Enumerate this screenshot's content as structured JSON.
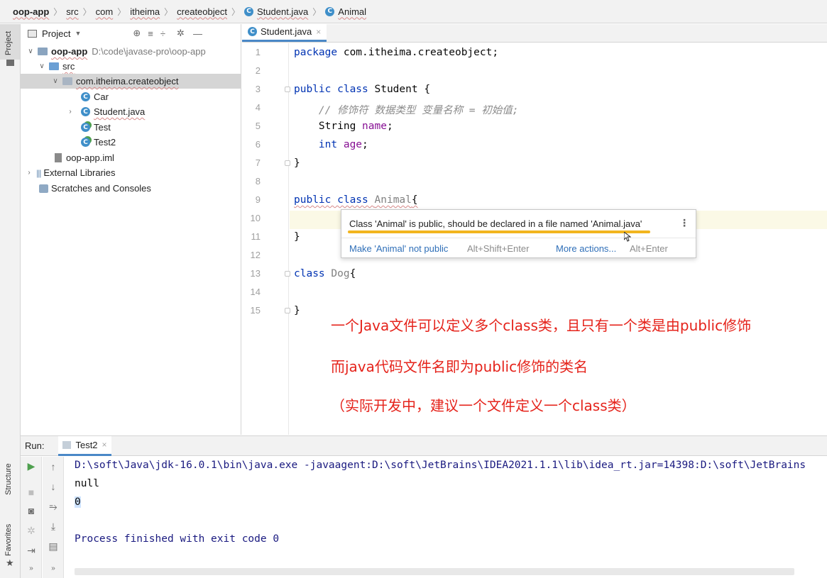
{
  "breadcrumbs": [
    "oop-app",
    "src",
    "com",
    "itheima",
    "createobject",
    "Student.java",
    "Animal"
  ],
  "left_strip": {
    "project_tab": "Project",
    "structure_tab": "Structure",
    "favorites_tab": "Favorites"
  },
  "project_panel": {
    "title": "Project",
    "tree": [
      {
        "label": "oop-app",
        "path": "D:\\code\\javase-pro\\oop-app"
      },
      {
        "label": "src"
      },
      {
        "label": "com.itheima.createobject"
      },
      {
        "label": "Car"
      },
      {
        "label": "Student.java"
      },
      {
        "label": "Test"
      },
      {
        "label": "Test2"
      },
      {
        "label": "oop-app.iml"
      },
      {
        "label": "External Libraries"
      },
      {
        "label": "Scratches and Consoles"
      }
    ]
  },
  "editor": {
    "tab": "Student.java",
    "line_numbers": [
      "1",
      "2",
      "3",
      "4",
      "5",
      "6",
      "7",
      "8",
      "9",
      "10",
      "11",
      "12",
      "13",
      "14",
      "15"
    ],
    "lines": {
      "l1_kw": "package",
      "l1_rest": " com.itheima.createobject;",
      "l3_kw": "public class",
      "l3_rest": " Student {",
      "l4": "    // 修饰符 数据类型 变量名称 = 初始值;",
      "l5_type": "    String ",
      "l5_field": "name",
      "l5_end": ";",
      "l6_type": "    int",
      "l6_sp": " ",
      "l6_field": "age",
      "l6_end": ";",
      "l7": "}",
      "l9_kw": "public class",
      "l9_sp": " ",
      "l9_name": "Animal",
      "l9_end": "{",
      "l11": "}",
      "l13_kw": "class",
      "l13_sp": " ",
      "l13_name": "Dog",
      "l13_end": "{",
      "l15": "}"
    }
  },
  "popup": {
    "message": "Class 'Animal' is public, should be declared in a file named 'Animal.java'",
    "fix_label": "Make 'Animal' not public",
    "fix_shortcut": "Alt+Shift+Enter",
    "more_label": "More actions...",
    "more_shortcut": "Alt+Enter"
  },
  "annotations": [
    "一个Java文件可以定义多个class类，且只有一个类是由public修饰",
    "而java代码文件名即为public修饰的类名",
    "（实际开发中，建议一个文件定义一个class类）"
  ],
  "run_panel": {
    "label": "Run:",
    "tab": "Test2",
    "output": [
      "D:\\soft\\Java\\jdk-16.0.1\\bin\\java.exe -javaagent:D:\\soft\\JetBrains\\IDEA2021.1.1\\lib\\idea_rt.jar=14398:D:\\soft\\JetBrains",
      "null",
      "0",
      "",
      "Process finished with exit code 0"
    ]
  },
  "colors": {
    "keyword": "#0033b3",
    "field": "#871094",
    "annotation": "#e5231b",
    "warning_underline": "#f2b51f",
    "link": "#2f6fb8"
  }
}
